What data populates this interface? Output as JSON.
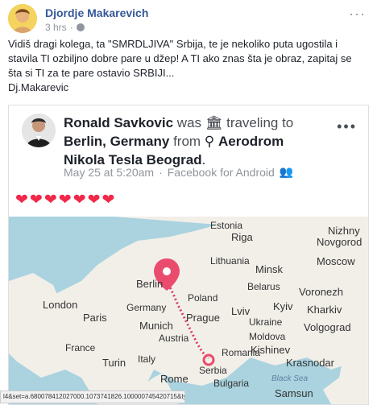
{
  "post": {
    "author": "Djordje Makarevich",
    "time": "3 hrs",
    "separator": "·",
    "more_icon": "···",
    "text_lines": [
      "Vidiš dragi kolega, ta \"SMRDLJIVA\" Srbija, te je nekoliko puta ugostila i",
      "stavila TI ozbiljno dobre pare u džep! A TI ako znas šta je obraz, zapitaj se",
      "šta si TI za te pare ostavio SRBIJI...",
      "Dj.Makarevic"
    ]
  },
  "shared": {
    "name": "Ronald Savkovic",
    "was": "was",
    "traveling": "traveling to",
    "destination": "Berlin, Germany",
    "from": "from",
    "origin": "Aerodrom Nikola Tesla Beograd",
    "period": ".",
    "date": "May 25 at 5:20am",
    "dot": "·",
    "source": "Facebook for Android",
    "hearts": [
      "❤",
      "❤",
      "❤",
      "❤",
      "❤",
      "❤",
      "❤"
    ],
    "more_icon": "•••"
  },
  "map": {
    "labels": [
      {
        "text": "Estonia"
      },
      {
        "text": "Riga"
      },
      {
        "text": "Nizhny"
      },
      {
        "text": "Novgorod"
      },
      {
        "text": "Lithuania"
      },
      {
        "text": "Minsk"
      },
      {
        "text": "Moscow"
      },
      {
        "text": "Berlin"
      },
      {
        "text": "Belarus"
      },
      {
        "text": "Voronezh"
      },
      {
        "text": "Poland"
      },
      {
        "text": "London"
      },
      {
        "text": "Germany"
      },
      {
        "text": "Lviv"
      },
      {
        "text": "Kyiv"
      },
      {
        "text": "Kharkiv"
      },
      {
        "text": "Paris"
      },
      {
        "text": "Munich"
      },
      {
        "text": "Prague"
      },
      {
        "text": "Ukraine"
      },
      {
        "text": "Volgograd"
      },
      {
        "text": "Austria"
      },
      {
        "text": "Moldova"
      },
      {
        "text": "France"
      },
      {
        "text": "Kishinev"
      },
      {
        "text": "Turin"
      },
      {
        "text": "Italy"
      },
      {
        "text": "Romania"
      },
      {
        "text": "Krasnodar"
      },
      {
        "text": "Rome"
      },
      {
        "text": "Serbia"
      },
      {
        "text": "Bulgaria"
      },
      {
        "text": "Black Sea"
      },
      {
        "text": "Samsun"
      }
    ],
    "colors": {
      "water": "#aad3df",
      "land": "#f2efe9",
      "route": "#d63c62",
      "pin": "#ea4c6e"
    }
  },
  "status_url": "l4&set=a.680078412027000.1073741826.100000745420715&type=3"
}
